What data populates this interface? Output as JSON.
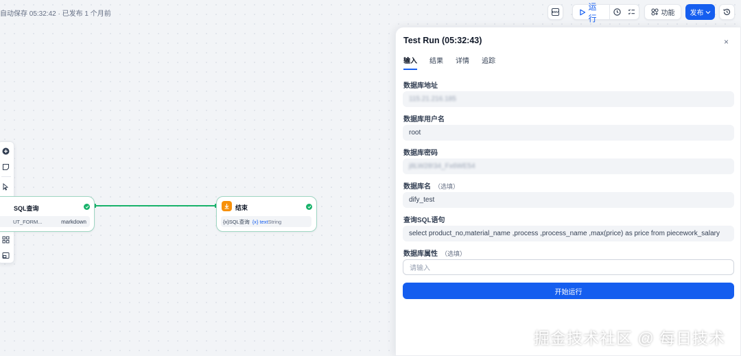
{
  "status": {
    "save_text": "自动保存 05:32:42 · 已发布 1 个月前"
  },
  "toolbar": {
    "env_label": "ENV",
    "run_label": "运行",
    "features_label": "功能",
    "publish_label": "发布"
  },
  "nodes": [
    {
      "title": "SQL查询",
      "rows": [
        {
          "left": "UT_FORM...",
          "right": "markdown"
        }
      ]
    },
    {
      "title": "结束",
      "rows": [
        {
          "prefix": "{x}",
          "left": "SQL查询",
          "var_icon": "{x}",
          "var": "text",
          "type": "String"
        }
      ]
    }
  ],
  "panel": {
    "title": "Test Run (05:32:43)",
    "close": "×",
    "tabs": [
      "输入",
      "结果",
      "详情",
      "追踪"
    ],
    "active_tab": "输入",
    "fields": [
      {
        "label": "数据库地址",
        "optional": "",
        "value": "115.21.216.185",
        "blurred": true
      },
      {
        "label": "数据库用户名",
        "optional": "",
        "value": "root",
        "blurred": false
      },
      {
        "label": "数据库密码",
        "optional": "",
        "value": "j8LW28!34_Fx6WE54",
        "blurred": true
      },
      {
        "label": "数据库名",
        "optional": "（选填）",
        "value": "dify_test",
        "blurred": false
      },
      {
        "label": "查询SQL语句",
        "optional": "",
        "value": "select  product_no,material_name ,process ,process_name ,max(price) as price  from piecework_salary",
        "blurred": false
      },
      {
        "label": "数据库属性",
        "optional": "（选填）",
        "placeholder": "请输入"
      }
    ],
    "start_button": "开始运行"
  },
  "watermark": "掘金技术社区 @ 每日技术",
  "colors": {
    "accent": "#155eef",
    "success": "#17b26a",
    "node_border": "#9fd6c3",
    "end_icon": "#f79009"
  }
}
